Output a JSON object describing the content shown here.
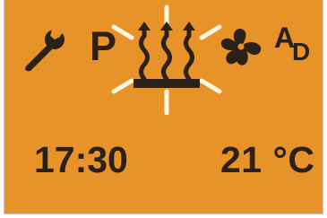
{
  "display": {
    "background_color": "#e8922a",
    "foreground_color": "#2b2118",
    "highlight_color": "#fff6e0"
  },
  "status_icons": [
    {
      "name": "wrench-icon",
      "state": "visible"
    },
    {
      "name": "program-indicator",
      "label": "P",
      "state": "visible"
    },
    {
      "name": "floor-heating-icon",
      "state": "active-flashing"
    },
    {
      "name": "fan-icon",
      "state": "visible"
    },
    {
      "name": "auto-defrost-indicator",
      "label_main": "A",
      "label_sub": "D",
      "state": "visible"
    }
  ],
  "readouts": {
    "time": "17:30",
    "temperature": "21 °C"
  }
}
